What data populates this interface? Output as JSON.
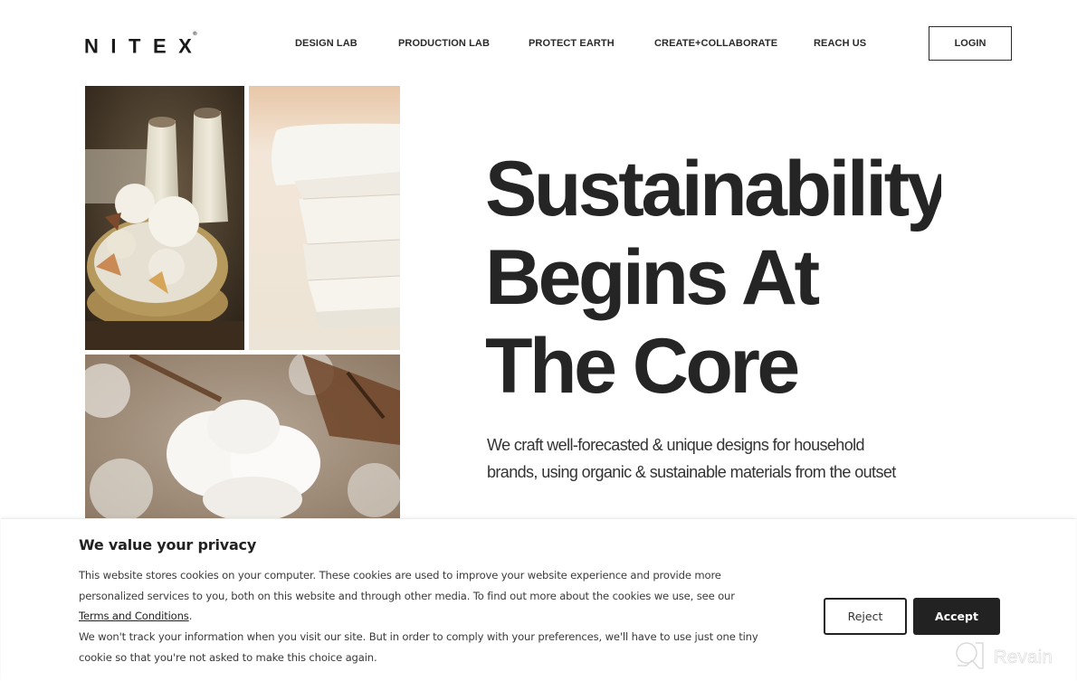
{
  "header": {
    "logo": "NITEX",
    "logo_mark": "®",
    "nav": [
      {
        "label": "DESIGN LAB"
      },
      {
        "label": "PRODUCTION LAB"
      },
      {
        "label": "PROTECT EARTH"
      },
      {
        "label": "CREATE+COLLABORATE"
      },
      {
        "label": "REACH US"
      }
    ],
    "login_label": "LOGIN"
  },
  "collage": [
    {
      "name": "basket-with-yarn-cones",
      "description": "Yarn cones and raw cotton in a woven basket"
    },
    {
      "name": "folded-white-fabric",
      "description": "Stack of folded white fabric"
    },
    {
      "name": "cotton-boll",
      "description": "Open cotton boll on the plant"
    }
  ],
  "hero": {
    "title_lines": [
      "Sustainability",
      "Begins At",
      "The Core"
    ],
    "subtitle_lines": [
      "We craft well-forecasted & unique designs for household",
      "brands, using organic & sustainable materials from the outset"
    ]
  },
  "cookie_banner": {
    "title": "We value your privacy",
    "body_1": "This website stores cookies on your computer. These cookies are used to improve your website experience and provide more personalized services to you, both on this website and through other media. To find out more about the cookies we use, see our ",
    "link_label": "Terms and Conditions",
    "body_1_end": ".",
    "body_2": "We won't track your information when you visit our site. But in order to comply with your preferences, we'll have to use just one tiny cookie so that you're not asked to make this choice again.",
    "reject_label": "Reject",
    "accept_label": "Accept"
  },
  "watermark": {
    "text": "Revain"
  },
  "colors": {
    "text_dark": "#252525",
    "accept_bg": "#222222",
    "background": "#ffffff"
  }
}
